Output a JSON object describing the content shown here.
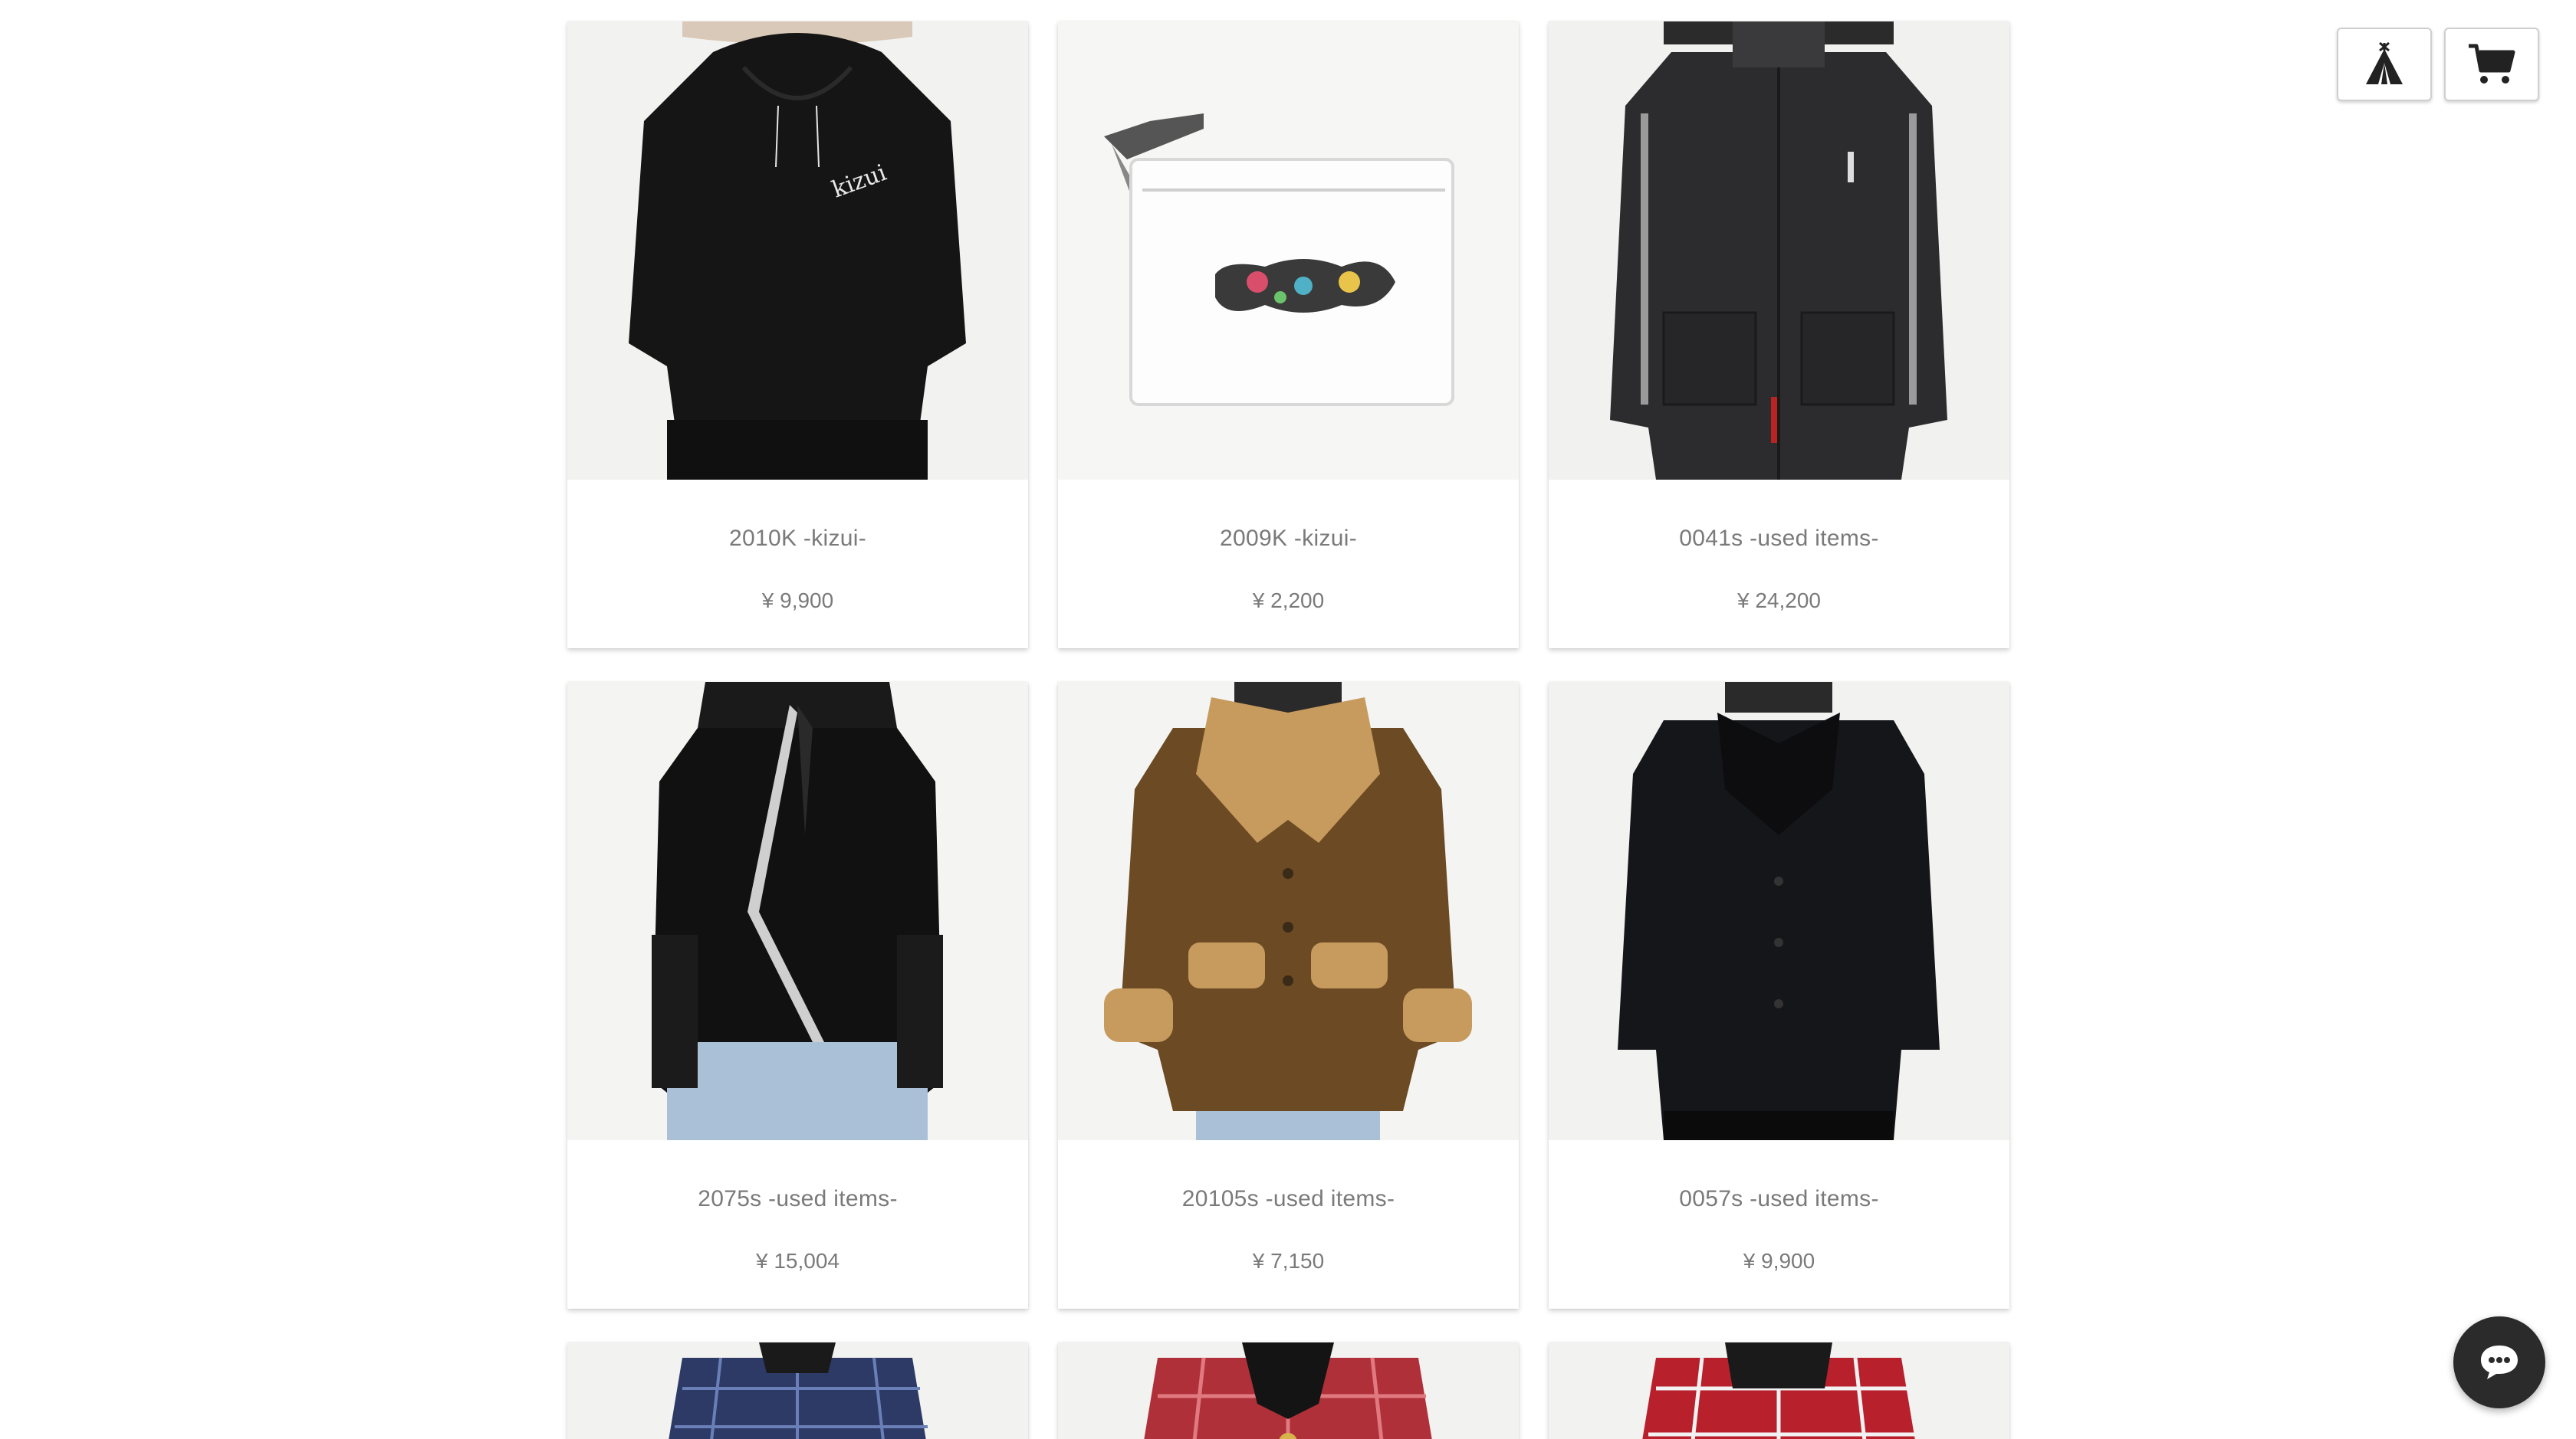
{
  "header": {
    "home_icon": "tent-icon",
    "cart_icon": "cart-icon"
  },
  "products": [
    {
      "title": "2010K -kizui-",
      "price": "¥ 9,900",
      "image": "black hoodie"
    },
    {
      "title": "2009K -kizui-",
      "price": "¥ 2,200",
      "image": "clear pouch with clip"
    },
    {
      "title": "0041s -used items-",
      "price": "¥ 24,200",
      "image": "black padded jacket"
    },
    {
      "title": "2075s -used items-",
      "price": "¥ 15,004",
      "image": "black leather zip jacket"
    },
    {
      "title": "20105s -used items-",
      "price": "¥ 7,150",
      "image": "brown shearling coat"
    },
    {
      "title": "0057s -used items-",
      "price": "¥ 9,900",
      "image": "black long coat"
    }
  ],
  "partial_products": [
    {
      "image": "navy plaid shirt"
    },
    {
      "image": "red plaid shirt"
    },
    {
      "image": "red plaid hooded shirt"
    }
  ],
  "chat": {
    "icon": "chat-bubble-icon"
  },
  "colors": {
    "text": "#7a7a7a",
    "chat_bg": "#2b2b2b",
    "background": "#ffffff"
  }
}
